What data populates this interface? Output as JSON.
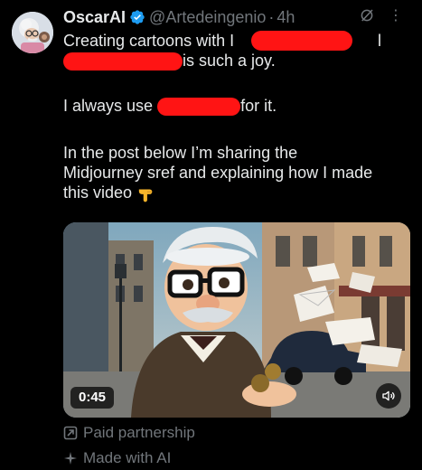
{
  "post": {
    "author_name": "OscarAI",
    "handle": "@Artedeingenio",
    "separator": "·",
    "time": "4h",
    "lines": {
      "l1": "Creating cartoons with",
      "l1_trail": "I",
      "l1_end": "l",
      "l2": "is such a joy.",
      "l3_start": "I always use",
      "l3_end": "for it.",
      "l4": "In the post below I’m sharing the",
      "l5": "Midjourney sref and explaining how I made",
      "l6": "this video"
    },
    "video": {
      "duration": "0:45"
    },
    "labels": {
      "paid": "Paid partnership",
      "made_with_ai": "Made with AI"
    }
  },
  "colors": {
    "background": "#000000",
    "text": "#e7e9ea",
    "secondary": "#71767b",
    "verified": "#1d9bf0",
    "redaction": "#ff1414"
  },
  "icons": [
    "avatar",
    "verified-badge-icon",
    "grok-icon",
    "more-icon",
    "pointing-down-emoji",
    "volume-icon",
    "paid-partnership-icon",
    "sparkle-icon"
  ]
}
